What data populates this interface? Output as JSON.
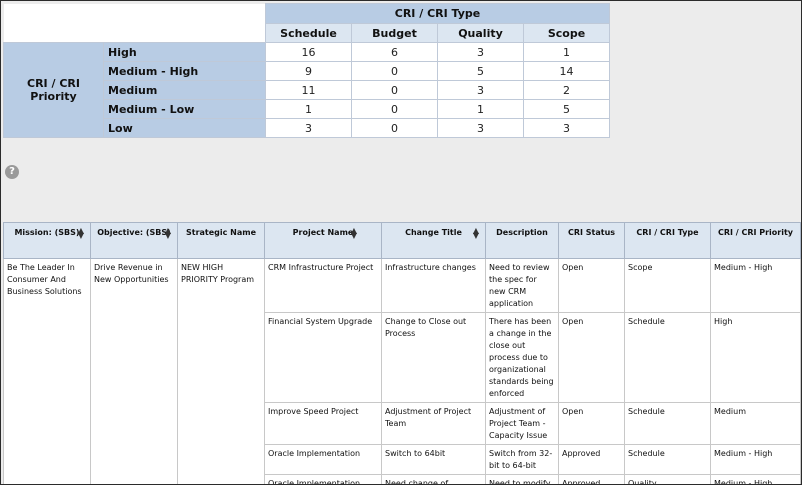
{
  "matrix": {
    "column_group_label": "CRI / CRI Type",
    "row_group_label": "CRI / CRI Priority",
    "columns": [
      "Schedule",
      "Budget",
      "Quality",
      "Scope"
    ],
    "rows": [
      {
        "label": "High",
        "values": [
          "16",
          "6",
          "3",
          "1"
        ]
      },
      {
        "label": "Medium - High",
        "values": [
          "9",
          "0",
          "5",
          "14"
        ]
      },
      {
        "label": "Medium",
        "values": [
          "11",
          "0",
          "3",
          "2"
        ]
      },
      {
        "label": "Medium - Low",
        "values": [
          "1",
          "0",
          "1",
          "5"
        ]
      },
      {
        "label": "Low",
        "values": [
          "3",
          "0",
          "3",
          "3"
        ]
      }
    ]
  },
  "help_icon": {
    "glyph": "?"
  },
  "details": {
    "headers": [
      {
        "label": "Mission: (SBS)",
        "sortable": true
      },
      {
        "label": "Objective: (SBS)",
        "sortable": true
      },
      {
        "label": "Strategic Name",
        "sortable": false
      },
      {
        "label": "Project Name",
        "sortable": true
      },
      {
        "label": "Change Title",
        "sortable": true
      },
      {
        "label": "Description",
        "sortable": false
      },
      {
        "label": "CRI Status",
        "sortable": false
      },
      {
        "label": "CRI / CRI Type",
        "sortable": false
      },
      {
        "label": "CRI / CRI Priority",
        "sortable": false
      }
    ],
    "mission": "Be The Leader In Consumer And Business Solutions",
    "objective": "Drive Revenue in New Opportunities",
    "strategic_name": "NEW HIGH PRIORITY Program",
    "rows": [
      {
        "project": "CRM Infrastructure Project",
        "change_title": "Infrastructure changes",
        "description": "Need to review the spec for new CRM application",
        "status": "Open",
        "type": "Scope",
        "priority": "Medium - High"
      },
      {
        "project": "Financial System Upgrade",
        "change_title": "Change to Close out Process",
        "description": "There has been a change in the close out process due to organizational standards being enforced",
        "status": "Open",
        "type": "Schedule",
        "priority": "High"
      },
      {
        "project": "Improve Speed Project",
        "change_title": "Adjustment of Project Team",
        "description": "Adjustment of Project Team - Capacity Issue",
        "status": "Open",
        "type": "Schedule",
        "priority": "Medium"
      },
      {
        "project": "Oracle Implementation",
        "change_title": "Switch to 64bit",
        "description": "Switch from 32-bit to 64-bit",
        "status": "Approved",
        "type": "Schedule",
        "priority": "Medium - High"
      },
      {
        "project": "Oracle Implementation",
        "change_title": "Need change of deliverable",
        "description": "Need to modify xyz pathway",
        "status": "Approved",
        "type": "Quality",
        "priority": "Medium - High"
      }
    ]
  }
}
